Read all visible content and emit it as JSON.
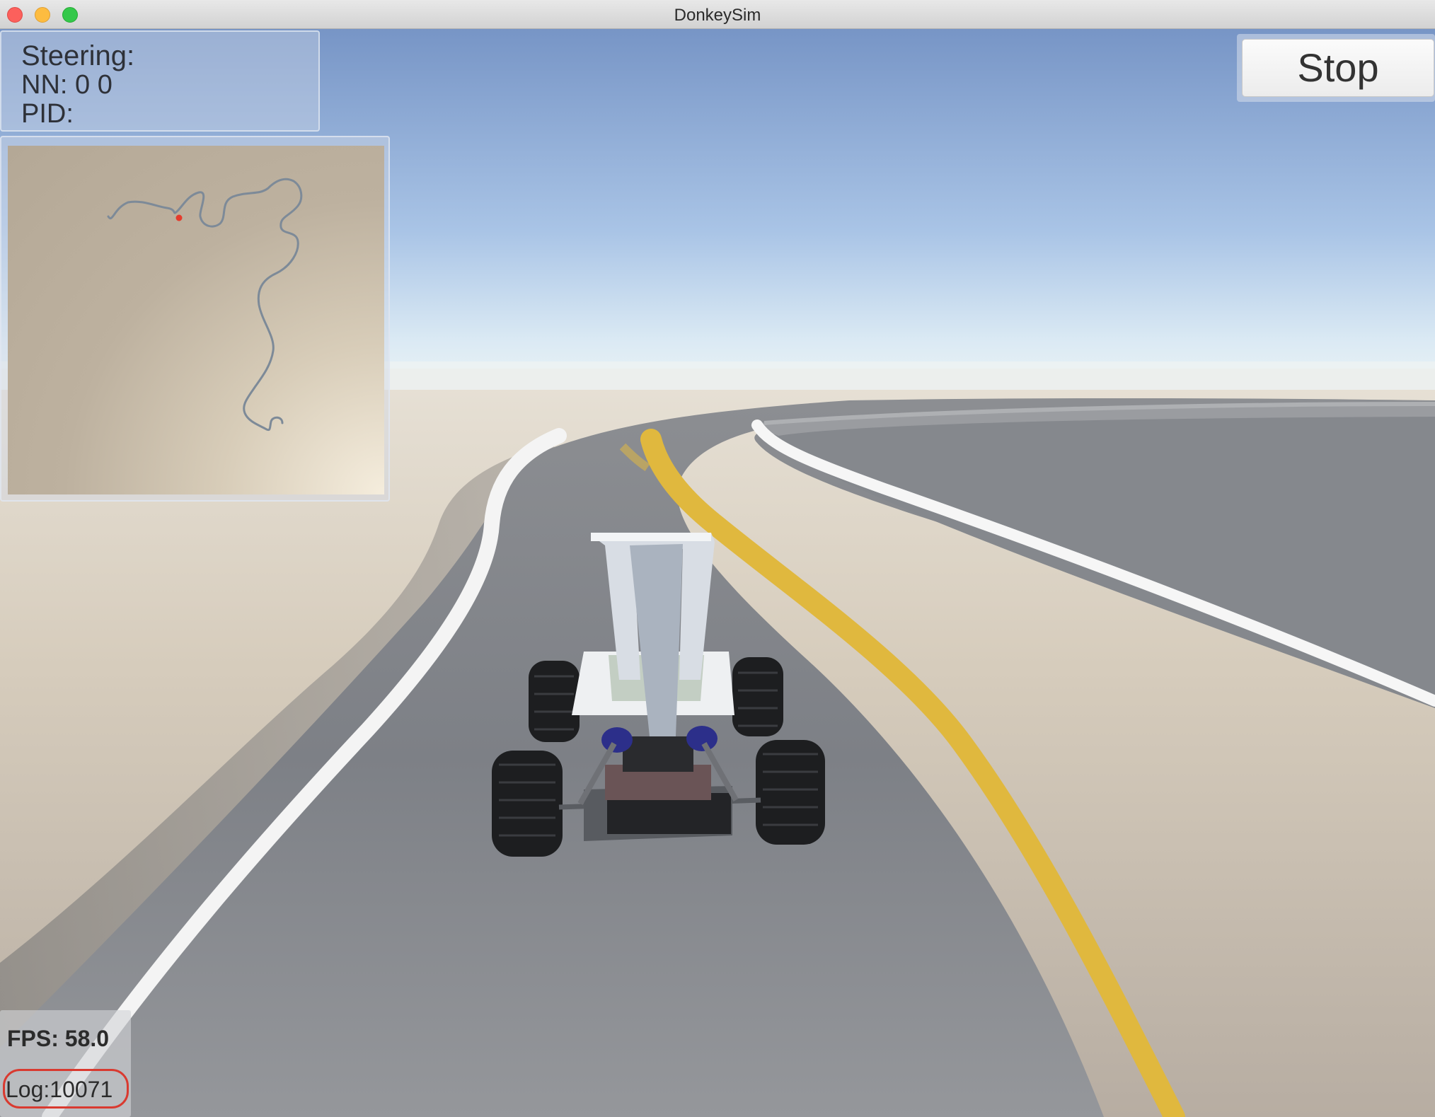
{
  "window": {
    "title": "DonkeySim"
  },
  "hud": {
    "steering_label": "Steering:",
    "nn_text": "NN: 0 0",
    "pid_label": "PID:"
  },
  "controls": {
    "stop_label": "Stop"
  },
  "stats": {
    "fps_text": "FPS: 58.0",
    "log_text": "Log:10071"
  },
  "minimap": {
    "car_marker_color": "#e53b2c",
    "track_color": "#7d8a98"
  },
  "colors": {
    "sky_top": "#7b9bc8",
    "sky_horizon": "#eaf2f8",
    "ground": "#d9cfbf",
    "road": "#7e8187",
    "center_line": "#e2b940",
    "edge_line": "#ffffff"
  }
}
